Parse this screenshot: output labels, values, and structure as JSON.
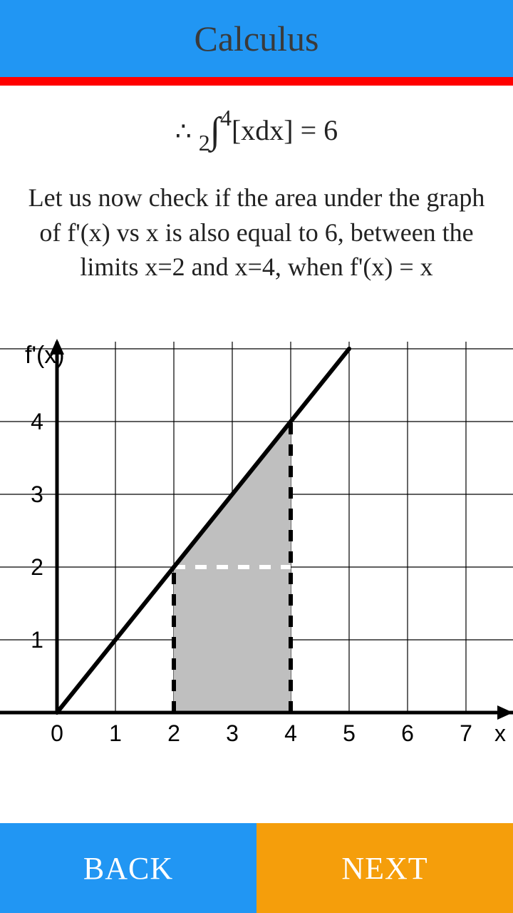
{
  "header": {
    "title": "Calculus"
  },
  "equation": {
    "therefore": "∴",
    "lower": "2",
    "integral": "∫",
    "upper": "4",
    "integrand": "[xdx] = 6"
  },
  "body": {
    "text": "Let us now check if the area under the graph of f'(x) vs x is also equal to 6, between the limits x=2 and x=4, when f'(x) = x"
  },
  "chart_data": {
    "type": "line",
    "title": "",
    "xlabel": "x",
    "ylabel": "f'(x)",
    "xlim": [
      0,
      7
    ],
    "ylim": [
      0,
      5
    ],
    "x_ticks": [
      0,
      1,
      2,
      3,
      4,
      5,
      6,
      7
    ],
    "y_ticks": [
      1,
      2,
      3,
      4
    ],
    "series": [
      {
        "name": "f'(x)=x",
        "x": [
          0,
          5
        ],
        "y": [
          0,
          5
        ]
      }
    ],
    "shaded_region": {
      "x_from": 2,
      "x_to": 4,
      "under_line": true,
      "area_value": 6
    },
    "annotations": {
      "vertical_dashed": [
        {
          "x": 2,
          "y0": 0,
          "y1": 2
        },
        {
          "x": 4,
          "y0": 0,
          "y1": 4
        }
      ],
      "horizontal_dashed": [
        {
          "y": 2,
          "x0": 2,
          "x1": 4
        }
      ]
    }
  },
  "footer": {
    "back_label": "BACK",
    "next_label": "NEXT"
  }
}
